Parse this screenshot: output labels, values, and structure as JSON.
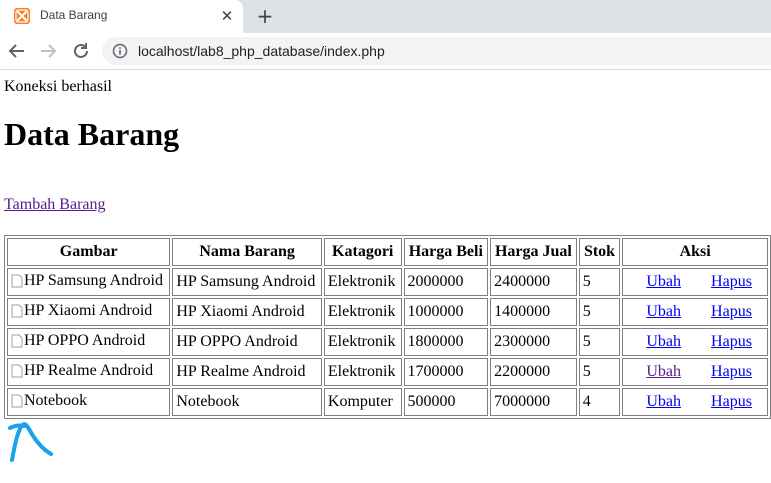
{
  "browser": {
    "tab_title": "Data Barang",
    "url": "localhost/lab8_php_database/index.php",
    "accent_favicon": "#fb7a24"
  },
  "page": {
    "status": "Koneksi berhasil",
    "title": "Data Barang",
    "add_link": "Tambah Barang"
  },
  "table": {
    "headers": [
      "Gambar",
      "Nama Barang",
      "Katagori",
      "Harga Beli",
      "Harga Jual",
      "Stok",
      "Aksi"
    ],
    "rows": [
      {
        "img_alt": "HP Samsung Android",
        "nama": "HP Samsung Android",
        "kategori": "Elektronik",
        "harga_beli": "2000000",
        "harga_jual": "2400000",
        "stok": "5",
        "ubah": "Ubah",
        "hapus": "Hapus"
      },
      {
        "img_alt": "HP Xiaomi Android",
        "nama": "HP Xiaomi Android",
        "kategori": "Elektronik",
        "harga_beli": "1000000",
        "harga_jual": "1400000",
        "stok": "5",
        "ubah": "Ubah",
        "hapus": "Hapus"
      },
      {
        "img_alt": "HP OPPO Android",
        "nama": "HP OPPO Android",
        "kategori": "Elektronik",
        "harga_beli": "1800000",
        "harga_jual": "2300000",
        "stok": "5",
        "ubah": "Ubah",
        "hapus": "Hapus"
      },
      {
        "img_alt": "HP Realme Android",
        "nama": "HP Realme Android",
        "kategori": "Elektronik",
        "harga_beli": "1700000",
        "harga_jual": "2200000",
        "stok": "5",
        "ubah": "Ubah",
        "hapus": "Hapus"
      },
      {
        "img_alt": "Notebook",
        "nama": "Notebook",
        "kategori": "Komputer",
        "harga_beli": "500000",
        "harga_jual": "7000000",
        "stok": "4",
        "ubah": "Ubah",
        "hapus": "Hapus"
      }
    ]
  },
  "colors": {
    "link": "#0000ee",
    "visited_link": "#551a8b",
    "annotation": "#1aa3e8"
  }
}
